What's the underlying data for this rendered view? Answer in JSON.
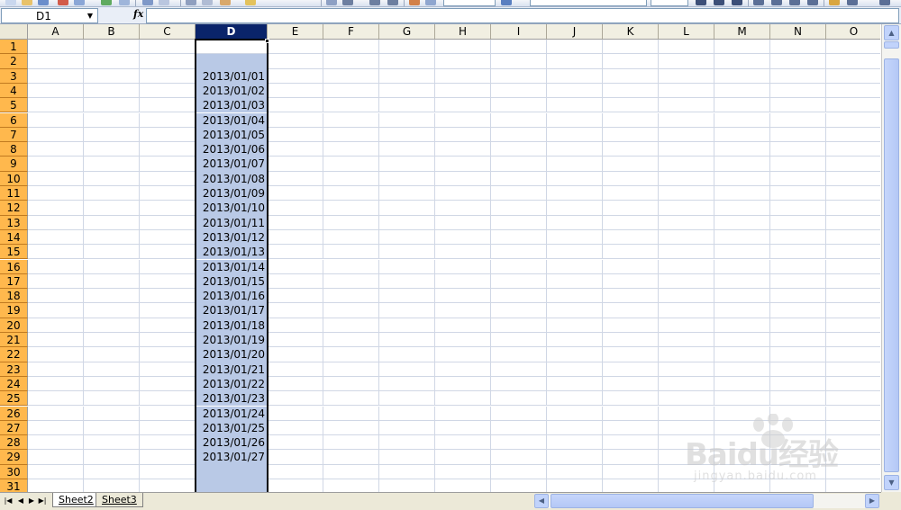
{
  "formula_bar": {
    "name_box": "D1",
    "fx_icon": "function-icon",
    "formula": ""
  },
  "columns": [
    "A",
    "B",
    "C",
    "D",
    "E",
    "F",
    "G",
    "H",
    "I",
    "J",
    "K",
    "L",
    "M",
    "N",
    "O"
  ],
  "selected_column": "D",
  "active_cell": "D1",
  "rows": [
    "1",
    "2",
    "3",
    "4",
    "5",
    "6",
    "7",
    "8",
    "9",
    "10",
    "11",
    "12",
    "13",
    "14",
    "15",
    "16",
    "17",
    "18",
    "19",
    "20",
    "21",
    "22",
    "23",
    "24",
    "25",
    "26",
    "27",
    "28",
    "29",
    "30",
    "31"
  ],
  "column_d_values": [
    "",
    "",
    "2013/01/01",
    "2013/01/02",
    "2013/01/03",
    "2013/01/04",
    "2013/01/05",
    "2013/01/06",
    "2013/01/07",
    "2013/01/08",
    "2013/01/09",
    "2013/01/10",
    "2013/01/11",
    "2013/01/12",
    "2013/01/13",
    "2013/01/14",
    "2013/01/15",
    "2013/01/16",
    "2013/01/17",
    "2013/01/18",
    "2013/01/19",
    "2013/01/20",
    "2013/01/21",
    "2013/01/22",
    "2013/01/23",
    "2013/01/24",
    "2013/01/25",
    "2013/01/26",
    "2013/01/27",
    "",
    ""
  ],
  "sheet_tabs": [
    "Sheet2",
    "Sheet3"
  ],
  "active_sheet": "Sheet2",
  "watermark": {
    "main": "Baidu经验",
    "sub": "jingyan.baidu.com"
  },
  "colors": {
    "selected_header": "#0a246a",
    "row_header": "#ffb84d",
    "selection_fill": "#b9c9e6",
    "gridline": "#d0d7e5"
  }
}
